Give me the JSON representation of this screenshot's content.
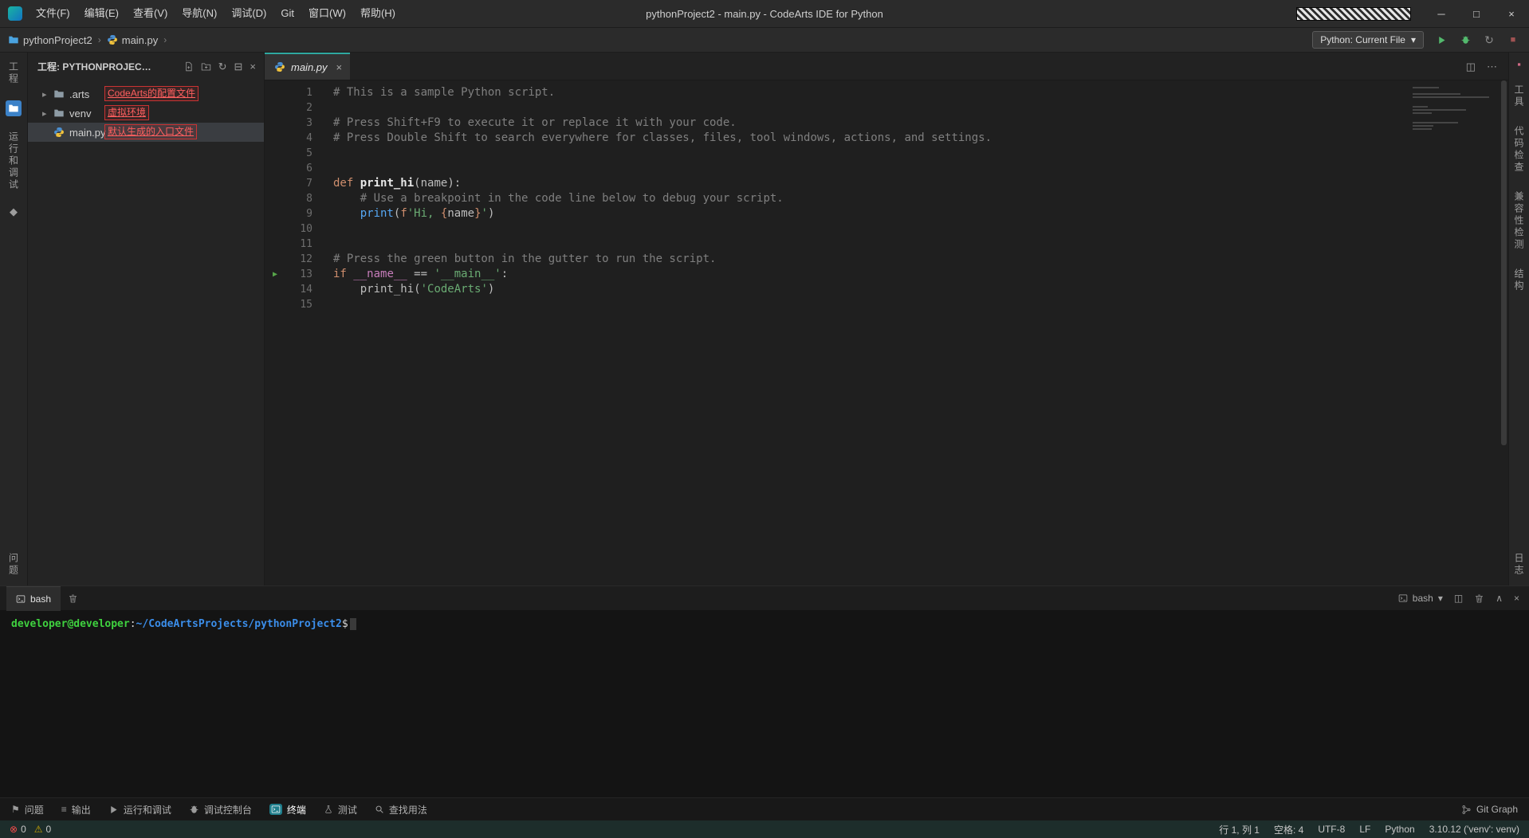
{
  "colors": {
    "accent_teal": "#2fa8a0",
    "run_green": "#53b96d",
    "annotation_red": "#ff5f5f",
    "string_green": "#6aab73",
    "keyword_orange": "#cf8e6d",
    "builtin_blue": "#56a8f5",
    "dunder_purple": "#c77dbb",
    "path_blue": "#3b8eea",
    "prompt_green": "#3fd23f",
    "error_red": "#f14c4c",
    "warning_yellow": "#cca700"
  },
  "titlebar": {
    "title": "pythonProject2 - main.py - CodeArts IDE for Python",
    "menus": [
      "文件(F)",
      "编辑(E)",
      "查看(V)",
      "导航(N)",
      "调试(D)",
      "Git",
      "窗口(W)",
      "帮助(H)"
    ],
    "window_controls": [
      "minimize",
      "maximize",
      "close"
    ]
  },
  "toolbar": {
    "breadcrumb": [
      {
        "icon": "folder",
        "label": "pythonProject2"
      },
      {
        "icon": "python",
        "label": "main.py"
      }
    ],
    "interpreter": "Python: Current File",
    "actions": [
      {
        "icon": "run",
        "name": "run-button",
        "cls": "green"
      },
      {
        "icon": "bug",
        "name": "debug-button",
        "cls": "green"
      },
      {
        "icon": "refresh",
        "name": "restart-button",
        "cls": "gray"
      },
      {
        "icon": "stop",
        "name": "stop-button",
        "cls": "reddim"
      }
    ]
  },
  "activity_left": {
    "top": [
      {
        "kind": "vlabel",
        "label": "工程",
        "name": "project"
      },
      {
        "kind": "icon",
        "icon": "files-blue",
        "name": "explorer"
      },
      {
        "kind": "vlabel",
        "label": "运行和调试",
        "name": "run-debug"
      },
      {
        "kind": "icon",
        "icon": "diamond",
        "name": "structure"
      }
    ],
    "bottom": [
      {
        "kind": "vlabel",
        "label": "问题",
        "name": "problems"
      }
    ]
  },
  "activity_right": {
    "top": [
      {
        "kind": "icon",
        "icon": "pink-square",
        "name": "plugin"
      },
      {
        "kind": "vlabel",
        "label": "工具",
        "name": "tools"
      },
      {
        "kind": "vlabel",
        "label": "代码检查",
        "name": "code-check"
      },
      {
        "kind": "vlabel",
        "label": "兼容性检测",
        "name": "compatibility"
      },
      {
        "kind": "vlabel",
        "label": "结构",
        "name": "outline"
      }
    ],
    "bottom": [
      {
        "kind": "vlabel",
        "label": "日志",
        "name": "logs"
      }
    ]
  },
  "explorer": {
    "title": "工程: PYTHONPROJEC…",
    "header_icons": [
      "new-file",
      "new-folder",
      "refresh",
      "collapse",
      "close"
    ],
    "tree": [
      {
        "label": ".arts",
        "chevron": true,
        "icon": "folder",
        "annotation": "CodeArts的配置文件"
      },
      {
        "label": "venv",
        "chevron": true,
        "icon": "folder",
        "annotation": "虚拟环境"
      },
      {
        "label": "main.py",
        "icon": "python",
        "annotation": "默认生成的入口文件",
        "selected": true
      }
    ]
  },
  "editor": {
    "tab": {
      "label": "main.py",
      "icon": "python"
    },
    "tab_actions": [
      "split",
      "more"
    ],
    "lines": [
      {
        "num": 1,
        "tokens": [
          [
            "# This is a sample Python script.",
            "c"
          ]
        ]
      },
      {
        "num": 2,
        "tokens": []
      },
      {
        "num": 3,
        "tokens": [
          [
            "# Press Shift+F9 to execute it or replace it with your code.",
            "c"
          ]
        ]
      },
      {
        "num": 4,
        "tokens": [
          [
            "# Press Double Shift to search everywhere for classes, files, tool windows, actions, and settings.",
            "c"
          ]
        ]
      },
      {
        "num": 5,
        "tokens": []
      },
      {
        "num": 6,
        "tokens": []
      },
      {
        "num": 7,
        "tokens": [
          [
            "def",
            "k"
          ],
          [
            " ",
            "o"
          ],
          [
            "print_hi",
            "f"
          ],
          [
            "(name):",
            "o"
          ]
        ]
      },
      {
        "num": 8,
        "tokens": [
          [
            "    # Use a breakpoint in the code line below to debug your script.",
            "c"
          ]
        ]
      },
      {
        "num": 9,
        "tokens": [
          [
            "    ",
            "o"
          ],
          [
            "print",
            "b"
          ],
          [
            "(",
            "o"
          ],
          [
            "f",
            "k"
          ],
          [
            "'Hi, ",
            "s"
          ],
          [
            "{",
            "br"
          ],
          [
            "name",
            "o"
          ],
          [
            "}",
            "br"
          ],
          [
            "'",
            "s"
          ],
          [
            ")",
            "o"
          ]
        ]
      },
      {
        "num": 10,
        "tokens": []
      },
      {
        "num": 11,
        "tokens": []
      },
      {
        "num": 12,
        "tokens": [
          [
            "# Press the green button in the gutter to run the script.",
            "c"
          ]
        ]
      },
      {
        "num": 13,
        "run": true,
        "tokens": [
          [
            "if",
            "k"
          ],
          [
            " ",
            "o"
          ],
          [
            "__name__",
            "d"
          ],
          [
            " == ",
            "o"
          ],
          [
            "'__main__'",
            "s"
          ],
          [
            ":",
            "o"
          ]
        ]
      },
      {
        "num": 14,
        "tokens": [
          [
            "    ",
            "o"
          ],
          [
            "print_hi",
            "o"
          ],
          [
            "(",
            "o"
          ],
          [
            "'CodeArts'",
            "s"
          ],
          [
            ")",
            "o"
          ]
        ]
      },
      {
        "num": 15,
        "tokens": []
      }
    ]
  },
  "terminal": {
    "tab": "bash",
    "right_label": "bash",
    "right_icons": [
      "split",
      "trash",
      "panel-up",
      "close"
    ],
    "prompt": [
      [
        "developer@developer",
        "user"
      ],
      [
        ":",
        "plain"
      ],
      [
        "~/CodeArtsProjects/pythonProject2",
        "path"
      ],
      [
        "$",
        "plain"
      ]
    ]
  },
  "panel_tabs": {
    "tabs": [
      {
        "icon": "flag",
        "label": "问题"
      },
      {
        "icon": "output",
        "label": "输出"
      },
      {
        "icon": "run",
        "label": "运行和调试"
      },
      {
        "icon": "bug",
        "label": "调试控制台"
      },
      {
        "icon": "terminal",
        "label": "终端",
        "active": true
      },
      {
        "icon": "flask",
        "label": "测试"
      },
      {
        "icon": "search",
        "label": "查找用法"
      }
    ],
    "right_label": "Git Graph"
  },
  "statusbar": {
    "problems": {
      "errors": "0",
      "warnings": "0"
    },
    "right": [
      "行 1, 列 1",
      "空格: 4",
      "UTF-8",
      "LF",
      "Python",
      "3.10.12 ('venv': venv)"
    ]
  }
}
